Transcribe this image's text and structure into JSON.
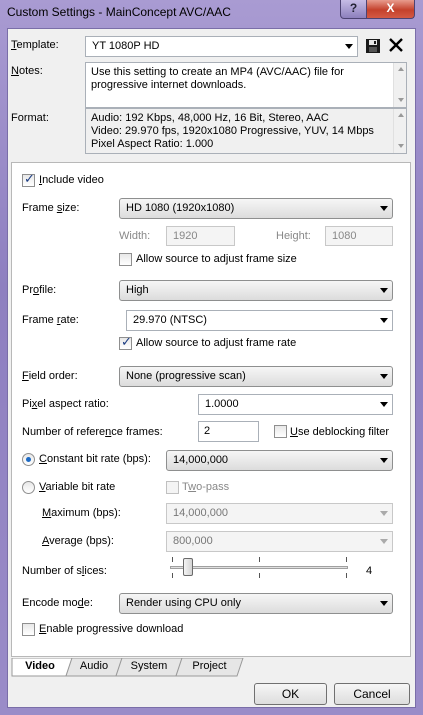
{
  "window": {
    "title": "Custom Settings - MainConcept AVC/AAC",
    "help_glyph": "?",
    "close_glyph": "X"
  },
  "template": {
    "label": "Template:",
    "value": "YT 1080P HD"
  },
  "notes": {
    "label": "Notes:",
    "value": "Use this setting to create an MP4 (AVC/AAC) file for progressive internet downloads."
  },
  "format": {
    "label": "Format:",
    "lines": [
      "Audio: 192 Kbps, 48,000 Hz, 16 Bit, Stereo, AAC",
      "Video: 29.970 fps, 1920x1080 Progressive, YUV, 14 Mbps",
      "Pixel Aspect Ratio: 1.000"
    ]
  },
  "video": {
    "include_video": {
      "label": "Include video",
      "checked": true
    },
    "frame_size": {
      "label": "Frame size:",
      "value": "HD 1080 (1920x1080)"
    },
    "width": {
      "label": "Width:",
      "value": "1920"
    },
    "height": {
      "label": "Height:",
      "value": "1080"
    },
    "allow_frame_size": {
      "label": "Allow source to adjust frame size",
      "checked": false
    },
    "profile": {
      "label": "Profile:",
      "value": "High"
    },
    "frame_rate": {
      "label": "Frame rate:",
      "value": "29.970 (NTSC)"
    },
    "allow_frame_rate": {
      "label": "Allow source to adjust frame rate",
      "checked": true
    },
    "field_order": {
      "label": "Field order:",
      "value": "None (progressive scan)"
    },
    "pixel_aspect": {
      "label": "Pixel aspect ratio:",
      "value": "1.0000"
    },
    "ref_frames": {
      "label": "Number of reference frames:",
      "value": "2"
    },
    "deblocking": {
      "label": "Use deblocking filter",
      "checked": false
    },
    "cbr": {
      "label": "Constant bit rate (bps):",
      "value": "14,000,000",
      "selected": true
    },
    "vbr": {
      "label": "Variable bit rate",
      "selected": false
    },
    "two_pass": {
      "label": "Two-pass",
      "checked": false
    },
    "maximum": {
      "label": "Maximum (bps):",
      "value": "14,000,000"
    },
    "average": {
      "label": "Average (bps):",
      "value": "800,000"
    },
    "slices": {
      "label": "Number of slices:",
      "value": "4",
      "fraction": 0.0
    },
    "encode_mode": {
      "label": "Encode mode:",
      "value": "Render using CPU only"
    },
    "progressive_download": {
      "label": "Enable progressive download",
      "checked": false
    }
  },
  "tabs": [
    "Video",
    "Audio",
    "System",
    "Project"
  ],
  "buttons": {
    "ok": "OK",
    "cancel": "Cancel"
  }
}
